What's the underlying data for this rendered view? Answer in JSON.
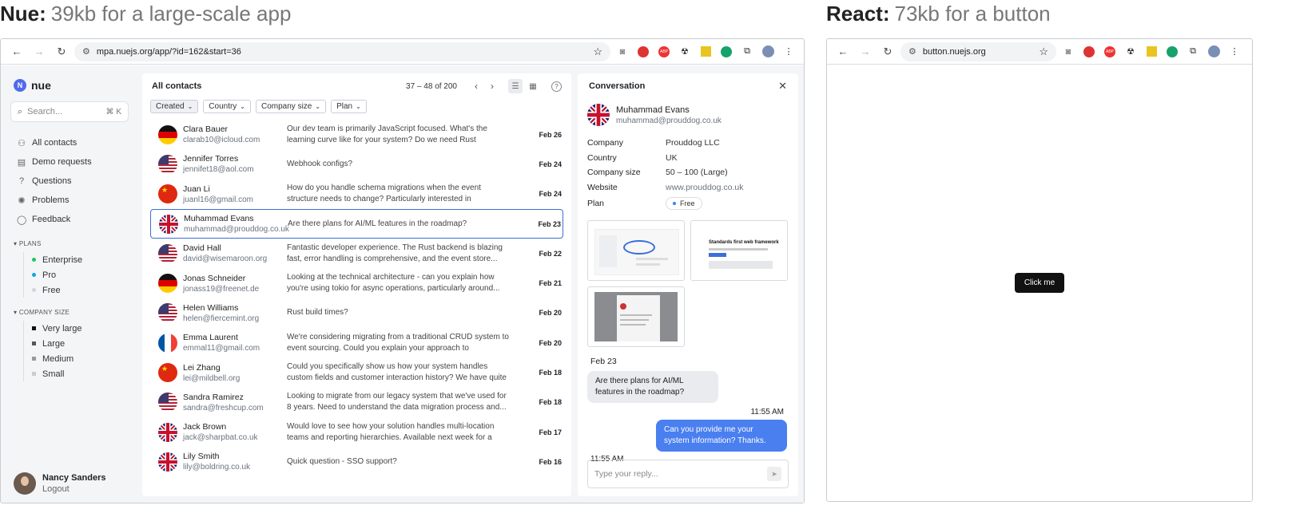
{
  "headings": {
    "left_bold": "Nue:",
    "left_sub": "39kb for a large-scale app",
    "right_bold": "React:",
    "right_sub": "73kb for a button"
  },
  "nue_browser": {
    "url": "mpa.nuejs.org/app/?id=162&start=36"
  },
  "react_browser": {
    "url": "button.nuejs.org",
    "button_label": "Click me"
  },
  "sidebar": {
    "logo": "nue",
    "search_placeholder": "Search...",
    "search_shortcut": "⌘ K",
    "nav": [
      {
        "label": "All contacts",
        "icon": "users-icon"
      },
      {
        "label": "Demo requests",
        "icon": "clapper-icon"
      },
      {
        "label": "Questions",
        "icon": "question-icon"
      },
      {
        "label": "Problems",
        "icon": "bug-icon"
      },
      {
        "label": "Feedback",
        "icon": "chat-icon"
      }
    ],
    "plans_title": "PLANS",
    "plans": [
      {
        "label": "Enterprise",
        "color": "#22c55e"
      },
      {
        "label": "Pro",
        "color": "#0ea5e9"
      },
      {
        "label": "Free",
        "color": "#d1d5db"
      }
    ],
    "size_title": "COMPANY SIZE",
    "sizes": [
      {
        "label": "Very large",
        "color": "#111111"
      },
      {
        "label": "Large",
        "color": "#555555"
      },
      {
        "label": "Medium",
        "color": "#999999"
      },
      {
        "label": "Small",
        "color": "#cccccc"
      }
    ],
    "user_name": "Nancy Sanders",
    "user_action": "Logout"
  },
  "contacts": {
    "title": "All contacts",
    "range": "37 – 48 of 200",
    "filters": [
      "Created",
      "Country",
      "Company size",
      "Plan"
    ],
    "rows": [
      {
        "name": "Clara Bauer",
        "email": "clarab10@icloud.com",
        "message": "Our dev team is primarily JavaScript focused. What's the learning curve like for your system? Do we need Rust knowled...",
        "date": "Feb 26",
        "flag": "de"
      },
      {
        "name": "Jennifer Torres",
        "email": "jennifet18@aol.com",
        "message": "Webhook configs?",
        "date": "Feb 24",
        "flag": "us"
      },
      {
        "name": "Juan Li",
        "email": "juanl16@gmail.com",
        "message": "How do you handle schema migrations when the event structure needs to change? Particularly interested in backward...",
        "date": "Feb 24",
        "flag": "cn"
      },
      {
        "name": "Muhammad Evans",
        "email": "muhammad@prouddog.co.uk",
        "message": "Are there plans for AI/ML features in the roadmap?",
        "date": "Feb 23",
        "flag": "uk",
        "selected": true
      },
      {
        "name": "David Hall",
        "email": "david@wisemaroon.org",
        "message": "Fantastic developer experience. The Rust backend is blazing fast, error handling is comprehensive, and the event store...",
        "date": "Feb 22",
        "flag": "us"
      },
      {
        "name": "Jonas Schneider",
        "email": "jonass19@freenet.de",
        "message": "Looking at the technical architecture - can you explain how you're using tokio for async operations, particularly around...",
        "date": "Feb 21",
        "flag": "de"
      },
      {
        "name": "Helen Williams",
        "email": "helen@fiercemint.org",
        "message": "Rust build times?",
        "date": "Feb 20",
        "flag": "us"
      },
      {
        "name": "Emma Laurent",
        "email": "emmal11@gmail.com",
        "message": "We're considering migrating from a traditional CRUD system to event sourcing. Could you explain your approach to maintainin...",
        "date": "Feb 20",
        "flag": "fr"
      },
      {
        "name": "Lei Zhang",
        "email": "lei@mildbell.org",
        "message": "Could you specifically show us how your system handles custom fields and customer interaction history? We have quite a...",
        "date": "Feb 18",
        "flag": "cn"
      },
      {
        "name": "Sandra Ramirez",
        "email": "sandra@freshcup.com",
        "message": "Looking to migrate from our legacy system that we've used for 8 years. Need to understand the data migration process and...",
        "date": "Feb 18",
        "flag": "us"
      },
      {
        "name": "Jack Brown",
        "email": "jack@sharpbat.co.uk",
        "message": "Would love to see how your solution handles multi-location teams and reporting hierarchies. Available next week for a demo.",
        "date": "Feb 17",
        "flag": "uk"
      },
      {
        "name": "Lily Smith",
        "email": "lily@boldring.co.uk",
        "message": "Quick question - SSO support?",
        "date": "Feb 16",
        "flag": "uk"
      }
    ]
  },
  "conversation": {
    "title": "Conversation",
    "name": "Muhammad Evans",
    "email": "muhammad@prouddog.co.uk",
    "fields": [
      {
        "key": "Company",
        "value": "Prouddog LLC"
      },
      {
        "key": "Country",
        "value": "UK"
      },
      {
        "key": "Company size",
        "value": "50 – 100 (Large)"
      },
      {
        "key": "Website",
        "value": "www.prouddog.co.uk"
      }
    ],
    "plan_label": "Plan",
    "plan_value": "Free",
    "thumb_text_1": "Standards first web framework",
    "date_label": "Feb 23",
    "incoming": "Are there plans for AI/ML features in the roadmap?",
    "time_1": "11:55 AM",
    "outgoing": "Can you provide me your system information? Thanks.",
    "time_2": "11:55 AM",
    "reply_placeholder": "Type your reply..."
  }
}
